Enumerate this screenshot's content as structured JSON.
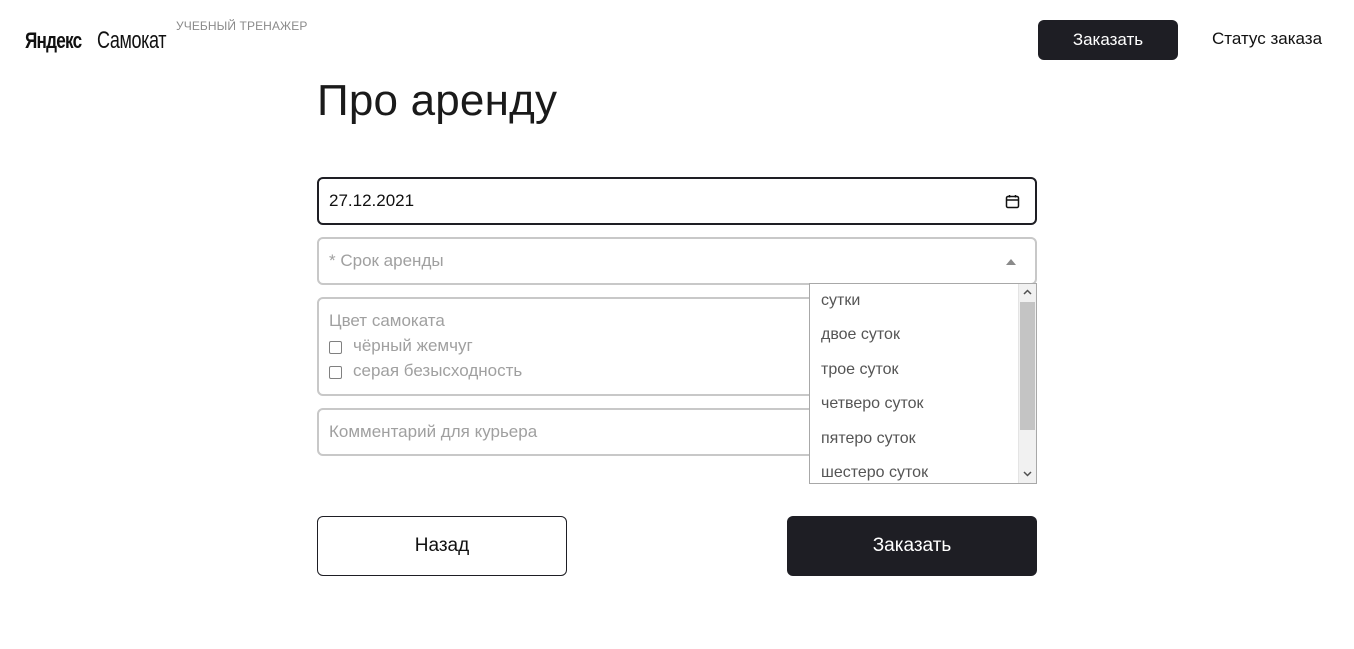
{
  "header": {
    "logo_primary": "Яндекс",
    "logo_secondary": "Самокат",
    "logo_subtitle": "УЧЕБНЫЙ ТРЕНАЖЕР",
    "order_button_label": "Заказать",
    "status_link_label": "Статус заказа"
  },
  "page": {
    "title": "Про аренду"
  },
  "form": {
    "date": {
      "value": "27.12.2021",
      "icon": "calendar-icon"
    },
    "rental_period": {
      "placeholder": "* Срок аренды",
      "icon": "caret-up-icon",
      "expanded": true,
      "options": [
        "сутки",
        "двое суток",
        "трое суток",
        "четверо суток",
        "пятеро суток",
        "шестеро суток"
      ]
    },
    "color": {
      "label": "Цвет самоката",
      "options": [
        {
          "label": "чёрный жемчуг",
          "checked": false
        },
        {
          "label": "серая безысходность",
          "checked": false
        }
      ]
    },
    "comment": {
      "placeholder": "Комментарий для курьера"
    }
  },
  "actions": {
    "back_label": "Назад",
    "submit_label": "Заказать"
  },
  "colors": {
    "primary_dark": "#1e1e24",
    "field_border": "#c8c8c8",
    "placeholder": "#a0a0a0"
  }
}
